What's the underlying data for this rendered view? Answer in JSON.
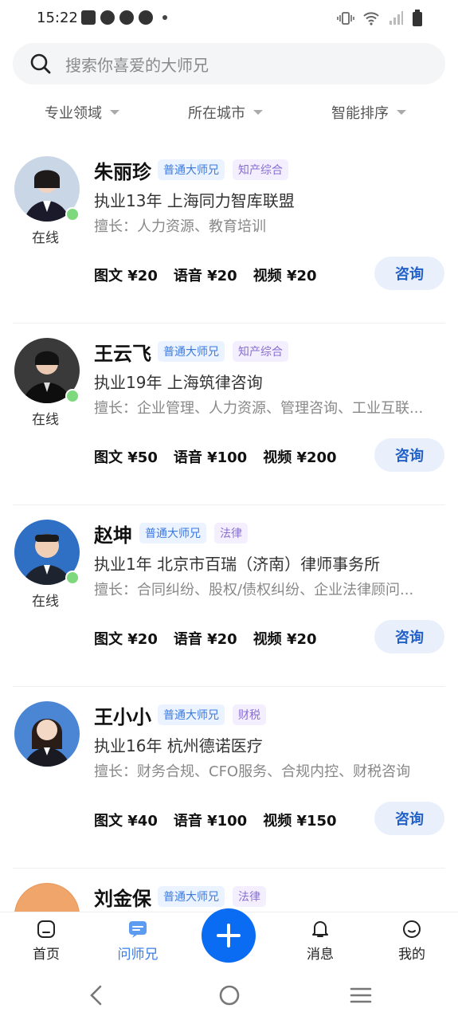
{
  "status": {
    "time": "15:22"
  },
  "search": {
    "placeholder": "搜索你喜爱的大师兄"
  },
  "filters": {
    "field": "专业领域",
    "city": "所在城市",
    "sort": "智能排序"
  },
  "consultants": [
    {
      "name": "朱丽珍",
      "tags": [
        "普通大师兄",
        "知产综合"
      ],
      "subtitle": "执业13年 上海同力智库联盟",
      "expertise": "擅长：人力资源、教育培训",
      "online": "在线",
      "prices": [
        "图文 ¥20",
        "语音 ¥20",
        "视频 ¥20"
      ],
      "action": "咨询"
    },
    {
      "name": "王云飞",
      "tags": [
        "普通大师兄",
        "知产综合"
      ],
      "subtitle": "执业19年 上海筑律咨询",
      "expertise": "擅长：企业管理、人力资源、管理咨询、工业互联...",
      "online": "在线",
      "prices": [
        "图文 ¥50",
        "语音 ¥100",
        "视频 ¥200"
      ],
      "action": "咨询"
    },
    {
      "name": "赵坤",
      "tags": [
        "普通大师兄",
        "法律"
      ],
      "subtitle": "执业1年 北京市百瑞（济南）律师事务所",
      "expertise": "擅长：合同纠纷、股权/债权纠纷、企业法律顾问...",
      "online": "在线",
      "prices": [
        "图文 ¥20",
        "语音 ¥20",
        "视频 ¥20"
      ],
      "action": "咨询"
    },
    {
      "name": "王小小",
      "tags": [
        "普通大师兄",
        "财税"
      ],
      "subtitle": "执业16年 杭州德诺医疗",
      "expertise": "擅长：财务合规、CFO服务、合规内控、财税咨询",
      "online": "",
      "prices": [
        "图文 ¥40",
        "语音 ¥100",
        "视频 ¥150"
      ],
      "action": "咨询"
    },
    {
      "name": "刘金保",
      "tags": [
        "普通大师兄",
        "法律"
      ]
    }
  ],
  "bottom_nav": {
    "home": "首页",
    "ask": "问师兄",
    "messages": "消息",
    "me": "我的"
  },
  "colors": {
    "accent": "#0a6cf2",
    "online": "#7ed87e",
    "button_bg": "#e9f0fb"
  }
}
